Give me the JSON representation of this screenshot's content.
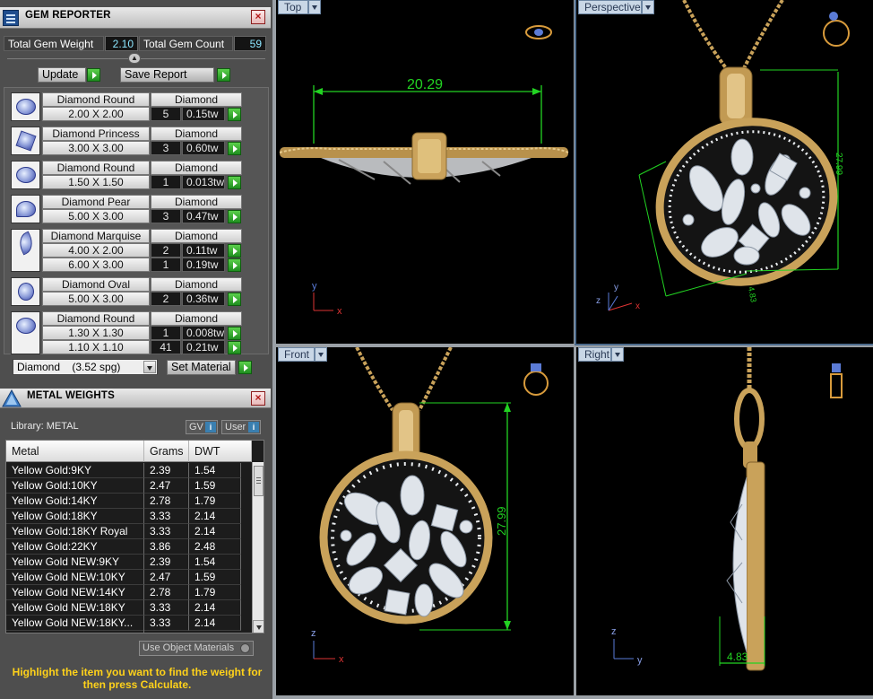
{
  "gem_reporter": {
    "title": "GEM REPORTER",
    "total_weight_label": "Total Gem Weight",
    "total_weight_value": "2.10",
    "total_count_label": "Total Gem Count",
    "total_count_value": "59",
    "update_label": "Update",
    "save_report_label": "Save Report",
    "gems": [
      {
        "name": "Diamond Round",
        "material": "Diamond",
        "shape": "round",
        "sizes": [
          {
            "size": "2.00 X 2.00",
            "count": "5",
            "weight": "0.15tw"
          }
        ]
      },
      {
        "name": "Diamond Princess",
        "material": "Diamond",
        "shape": "princess",
        "sizes": [
          {
            "size": "3.00 X 3.00",
            "count": "3",
            "weight": "0.60tw"
          }
        ]
      },
      {
        "name": "Diamond Round",
        "material": "Diamond",
        "shape": "round",
        "sizes": [
          {
            "size": "1.50 X 1.50",
            "count": "1",
            "weight": "0.013tw"
          }
        ]
      },
      {
        "name": "Diamond Pear",
        "material": "Diamond",
        "shape": "pear",
        "sizes": [
          {
            "size": "5.00 X 3.00",
            "count": "3",
            "weight": "0.47tw"
          }
        ]
      },
      {
        "name": "Diamond Marquise",
        "material": "Diamond",
        "shape": "marquise",
        "sizes": [
          {
            "size": "4.00 X 2.00",
            "count": "2",
            "weight": "0.11tw"
          },
          {
            "size": "6.00 X 3.00",
            "count": "1",
            "weight": "0.19tw"
          }
        ]
      },
      {
        "name": "Diamond Oval",
        "material": "Diamond",
        "shape": "oval",
        "sizes": [
          {
            "size": "5.00 X 3.00",
            "count": "2",
            "weight": "0.36tw"
          }
        ]
      },
      {
        "name": "Diamond Round",
        "material": "Diamond",
        "shape": "round",
        "sizes": [
          {
            "size": "1.30 X 1.30",
            "count": "1",
            "weight": "0.008tw"
          },
          {
            "size": "1.10 X 1.10",
            "count": "41",
            "weight": "0.21tw"
          }
        ]
      }
    ],
    "material_select": "Diamond    (3.52 spg)",
    "set_material_label": "Set Material"
  },
  "metal_weights": {
    "title": "METAL WEIGHTS",
    "library_label": "Library: METAL",
    "gv_label": "GV",
    "user_label": "User",
    "columns": [
      "Metal",
      "Grams",
      "DWT"
    ],
    "rows": [
      [
        "Yellow Gold:9KY",
        "2.39",
        "1.54"
      ],
      [
        "Yellow Gold:10KY",
        "2.47",
        "1.59"
      ],
      [
        "Yellow Gold:14KY",
        "2.78",
        "1.79"
      ],
      [
        "Yellow Gold:18KY",
        "3.33",
        "2.14"
      ],
      [
        "Yellow Gold:18KY Royal",
        "3.33",
        "2.14"
      ],
      [
        "Yellow Gold:22KY",
        "3.86",
        "2.48"
      ],
      [
        "Yellow Gold NEW:9KY",
        "2.39",
        "1.54"
      ],
      [
        "Yellow Gold NEW:10KY",
        "2.47",
        "1.59"
      ],
      [
        "Yellow Gold NEW:14KY",
        "2.78",
        "1.79"
      ],
      [
        "Yellow Gold NEW:18KY",
        "3.33",
        "2.14"
      ],
      [
        "Yellow Gold NEW:18KY...",
        "3.33",
        "2.14"
      ]
    ],
    "use_object_materials_label": "Use Object Materials",
    "hint_text": "Highlight the item you want to find the weight for then press Calculate."
  },
  "viewports": {
    "top": {
      "label": "Top",
      "dimension": "20.29"
    },
    "perspective": {
      "label": "Perspective",
      "dimension": "27.99"
    },
    "front": {
      "label": "Front",
      "dimension": "27.99"
    },
    "right": {
      "label": "Right",
      "dimension": "4.83"
    },
    "axes": {
      "x": "x",
      "y": "y",
      "z": "z"
    }
  },
  "colors": {
    "dimension_green": "#22d322",
    "gold": "#c9a25a",
    "viewport_bg": "#000000",
    "accent_blue": "#4c6a8c"
  }
}
